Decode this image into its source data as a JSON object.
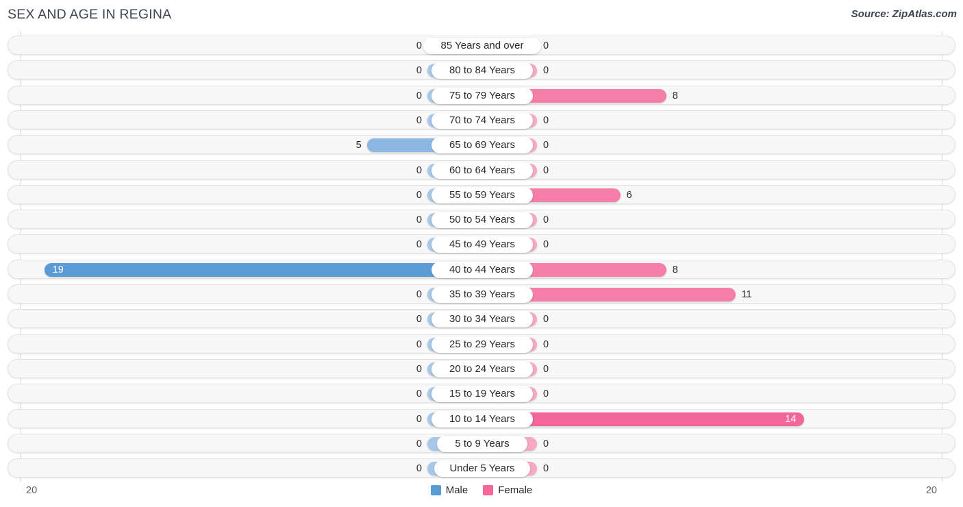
{
  "header": {
    "title": "SEX AND AGE IN REGINA",
    "source": "Source: ZipAtlas.com"
  },
  "legend": {
    "male_label": "Male",
    "female_label": "Female"
  },
  "axis": {
    "left_tick": "20",
    "right_tick": "20"
  },
  "colors": {
    "male_strong": "#5b9bd5",
    "male_mid": "#8cb7e3",
    "male_light": "#a8c8ea",
    "female_strong": "#f4659a",
    "female_mid": "#f57fa8",
    "female_light": "#f7a9c4",
    "row_background": "#f7f7f7",
    "row_border": "#e2e2e2"
  },
  "chart_data": {
    "type": "bar",
    "subtype": "population-pyramid",
    "title": "SEX AND AGE IN REGINA",
    "xlabel": "",
    "ylabel": "",
    "xlim": [
      0,
      20
    ],
    "grid": false,
    "legend_position": "bottom-center",
    "categories": [
      "85 Years and over",
      "80 to 84 Years",
      "75 to 79 Years",
      "70 to 74 Years",
      "65 to 69 Years",
      "60 to 64 Years",
      "55 to 59 Years",
      "50 to 54 Years",
      "45 to 49 Years",
      "40 to 44 Years",
      "35 to 39 Years",
      "30 to 34 Years",
      "25 to 29 Years",
      "20 to 24 Years",
      "15 to 19 Years",
      "10 to 14 Years",
      "5 to 9 Years",
      "Under 5 Years"
    ],
    "series": [
      {
        "name": "Male",
        "side": "left",
        "color": "#5b9bd5",
        "values": [
          0,
          0,
          0,
          0,
          5,
          0,
          0,
          0,
          0,
          19,
          0,
          0,
          0,
          0,
          0,
          0,
          0,
          0
        ]
      },
      {
        "name": "Female",
        "side": "right",
        "color": "#f4659a",
        "values": [
          0,
          0,
          8,
          0,
          0,
          0,
          6,
          0,
          0,
          8,
          11,
          0,
          0,
          0,
          0,
          14,
          0,
          0
        ]
      }
    ]
  }
}
